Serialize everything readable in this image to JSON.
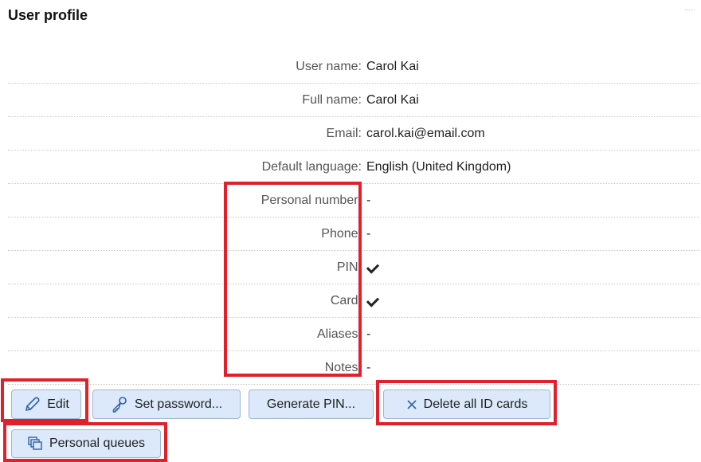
{
  "page": {
    "title": "User profile"
  },
  "fields": [
    {
      "label": "User name:",
      "value": "Carol Kai"
    },
    {
      "label": "Full name:",
      "value": "Carol Kai"
    },
    {
      "label": "Email:",
      "value": "carol.kai@email.com"
    },
    {
      "label": "Default language:",
      "value": "English (United Kingdom)"
    },
    {
      "label": "Personal number:",
      "value": "-"
    },
    {
      "label": "Phone:",
      "value": "-"
    },
    {
      "label": "PIN:",
      "value": "checkmark"
    },
    {
      "label": "Card:",
      "value": "checkmark"
    },
    {
      "label": "Aliases:",
      "value": "-"
    },
    {
      "label": "Notes:",
      "value": "-"
    }
  ],
  "buttons": {
    "edit": {
      "label": "Edit",
      "icon": "pencil-icon"
    },
    "set_password": {
      "label": "Set password...",
      "icon": "key-icon"
    },
    "generate_pin": {
      "label": "Generate PIN..."
    },
    "delete_cards": {
      "label": "Delete all ID cards",
      "icon": "close-icon"
    },
    "personal_queues": {
      "label": "Personal queues",
      "icon": "queues-icon"
    }
  },
  "colors": {
    "highlight": "#e0212b",
    "button_bg": "#dbe9fb",
    "button_border": "#9db6d6",
    "icon_blue": "#2f5fa8"
  }
}
